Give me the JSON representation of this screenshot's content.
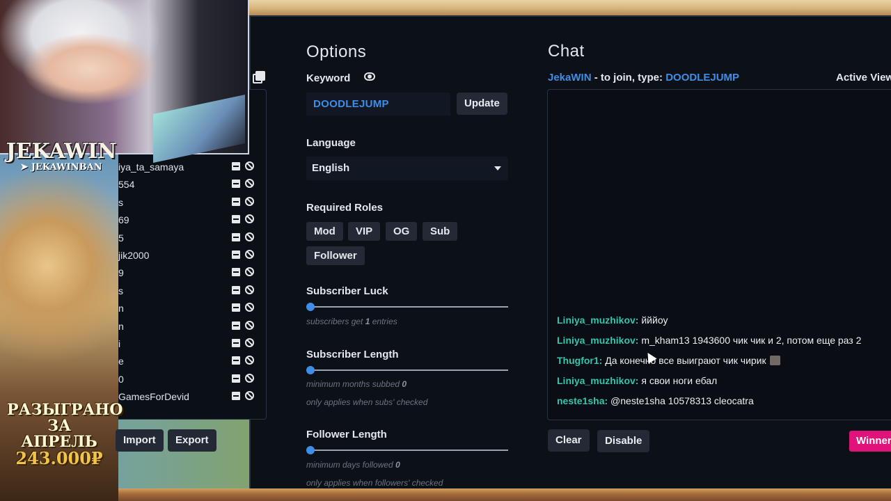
{
  "stream_overlay": {
    "brand_name": "JEKAWIN",
    "telegram_handle": "JEKAWINBAN",
    "promo_line1": "РАЗЫГРАНО",
    "promo_line2": "ЗА АПРЕЛЬ",
    "promo_amount": "243.000₽"
  },
  "entries_list": {
    "rows": [
      {
        "text": "iya_ta_samaya"
      },
      {
        "text": "554"
      },
      {
        "text": "s"
      },
      {
        "text": "69"
      },
      {
        "text": "5"
      },
      {
        "text": "jik2000"
      },
      {
        "text": "9"
      },
      {
        "text": "s"
      },
      {
        "text": "n"
      },
      {
        "text": "n"
      },
      {
        "text": "i"
      },
      {
        "text": "e"
      },
      {
        "text": "0"
      },
      {
        "text": "GamesForDevid"
      }
    ],
    "import_label": "Import",
    "export_label": "Export"
  },
  "options": {
    "title": "Options",
    "keyword_label": "Keyword",
    "keyword_value": "DOODLEJUMP",
    "update_label": "Update",
    "language_label": "Language",
    "language_value": "English",
    "required_roles_label": "Required Roles",
    "roles": [
      "Mod",
      "VIP",
      "OG",
      "Sub",
      "Follower"
    ],
    "subscriber_luck_label": "Subscriber Luck",
    "subscriber_luck_value": 0,
    "subscriber_luck_hint_pre": "subscribers get",
    "subscriber_luck_entries": "1",
    "subscriber_luck_hint_post": "entries",
    "subscriber_length_label": "Subscriber Length",
    "subscriber_length_value": 0,
    "subscriber_length_hint_pre": "minimum months subbed",
    "subscriber_length_months": "0",
    "subscriber_length_note": "only applies when subs' checked",
    "follower_length_label": "Follower Length",
    "follower_length_value": 0,
    "follower_length_hint_pre": "minimum days followed",
    "follower_length_days": "0",
    "follower_length_note": "only applies when followers' checked"
  },
  "chat": {
    "title": "Chat",
    "channel": "JekaWIN",
    "join_text": " - to join, type: ",
    "join_keyword": "DOODLEJUMP",
    "active_viewers_label": "Active View",
    "messages": [
      {
        "user": "Liniya_muzhikov:",
        "text": " йййоу"
      },
      {
        "user": "Liniya_muzhikov:",
        "text": " m_kham13 1943600 чик чик и 2, потом еще раз 2"
      },
      {
        "user": "Thugfor1:",
        "text": " Да конечно все выиграют чик чирик"
      },
      {
        "user": "Liniya_muzhikov:",
        "text": " я свои ноги ебал"
      },
      {
        "user": "neste1sha:",
        "text": " @neste1sha 10578313 cleocatra"
      }
    ],
    "clear_label": "Clear",
    "disable_label": "Disable",
    "winner_label": "Winner"
  },
  "colors": {
    "accent_blue": "#3e8ee8",
    "username_teal": "#36c4ad",
    "winner_pink": "#e0137a",
    "panel_bg": "#0c1118"
  }
}
